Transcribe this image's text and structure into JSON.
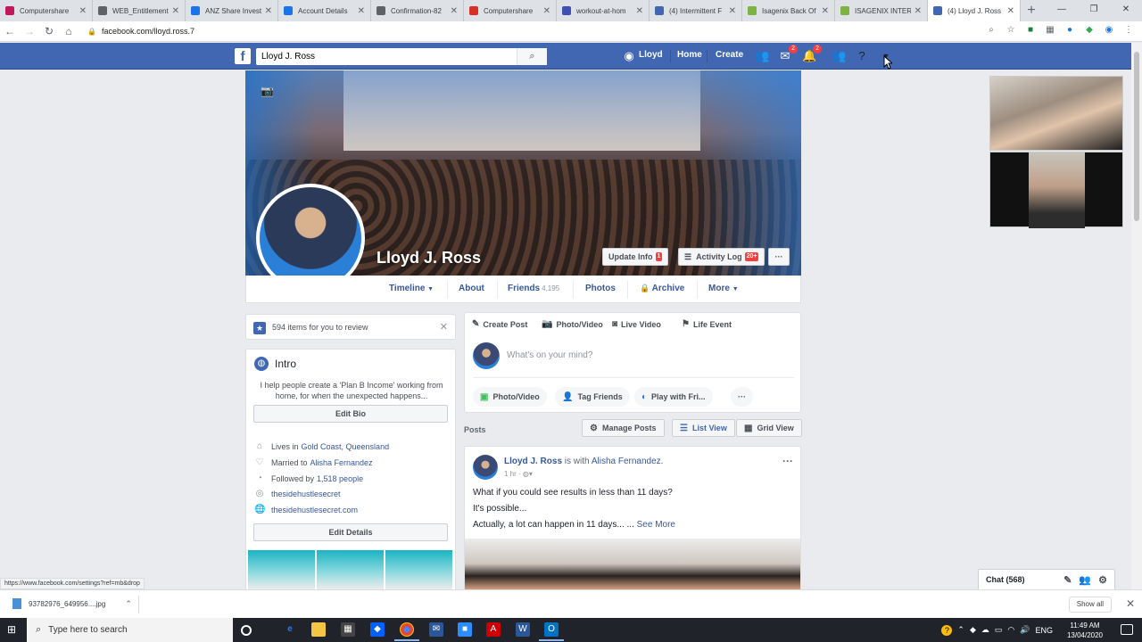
{
  "browser": {
    "tabs": [
      {
        "title": "Computershare",
        "color": "#c2185b"
      },
      {
        "title": "WEB_Entitlements",
        "color": "#5f6368"
      },
      {
        "title": "ANZ Share Invest",
        "color": "#1a73e8"
      },
      {
        "title": "Account Details",
        "color": "#1a73e8"
      },
      {
        "title": "Confirmation-82",
        "color": "#5f6368"
      },
      {
        "title": "Computershare",
        "color": "#d93025"
      },
      {
        "title": "workout-at-hom",
        "color": "#3f51b5"
      },
      {
        "title": "(4) Intermittent F",
        "color": "#4267b2"
      },
      {
        "title": "Isagenix Back Of",
        "color": "#7cb342"
      },
      {
        "title": "ISAGENIX INTER",
        "color": "#7cb342"
      },
      {
        "title": "(4) Lloyd J. Ross",
        "color": "#4267b2"
      }
    ],
    "new_tab": "+",
    "url": "facebook.com/lloyd.ross.7",
    "status_url": "https://www.facebook.com/settings?ref=mb&drop"
  },
  "fb_nav": {
    "logo": "f",
    "search_value": "Lloyd J. Ross",
    "user_link": "Lloyd",
    "home": "Home",
    "create": "Create",
    "messenger_badge": "2",
    "notif_badge": "2"
  },
  "profile": {
    "name": "Lloyd J. Ross",
    "update_info": "Update Info",
    "update_info_badge": "1",
    "activity_log": "Activity Log",
    "activity_badge": "20+",
    "more_dots": "···"
  },
  "profile_tabs": {
    "timeline": "Timeline",
    "about": "About",
    "friends": "Friends",
    "friends_count": "4,195",
    "photos": "Photos",
    "archive": "Archive",
    "more": "More"
  },
  "review": {
    "text": "594 items for you to review"
  },
  "intro": {
    "title": "Intro",
    "bio": "I help people create a 'Plan B Income' working from home, for when the unexpected happens...",
    "edit_bio": "Edit Bio",
    "lives_in_prefix": "Lives in",
    "lives_in": "Gold Coast, Queensland",
    "married_prefix": "Married to",
    "married_to": "Alisha Fernandez",
    "followed_prefix": "Followed by",
    "followed_by": "1,518 people",
    "instagram": "thesidehustlesecret",
    "website": "thesidehustlesecret.com",
    "edit_details": "Edit Details"
  },
  "composer": {
    "create_post": "Create Post",
    "photo_video": "Photo/Video",
    "live_video": "Live Video",
    "life_event": "Life Event",
    "placeholder": "What's on your mind?",
    "pill_photo": "Photo/Video",
    "pill_tag": "Tag Friends",
    "pill_play": "Play with Fri...",
    "pill_more": "···"
  },
  "posts_bar": {
    "label": "Posts",
    "manage": "Manage Posts",
    "list_view": "List View",
    "grid_view": "Grid View"
  },
  "post": {
    "author": "Lloyd J. Ross",
    "with_text": "is with",
    "tagged": "Alisha Fernandez.",
    "time": "1 hr",
    "line1": "What if you could see results in less than 11 days?",
    "line2": "It's possible...",
    "line3": "Actually, a lot can happen in 11 days... ...",
    "see_more": "See More",
    "more": "···"
  },
  "chat": {
    "label": "Chat (568)"
  },
  "downloads": {
    "file": "93782976_649956....jpg",
    "show_all": "Show all"
  },
  "taskbar": {
    "search_placeholder": "Type here to search",
    "lang": "ENG",
    "time": "11:49 AM",
    "date": "13/04/2020"
  }
}
